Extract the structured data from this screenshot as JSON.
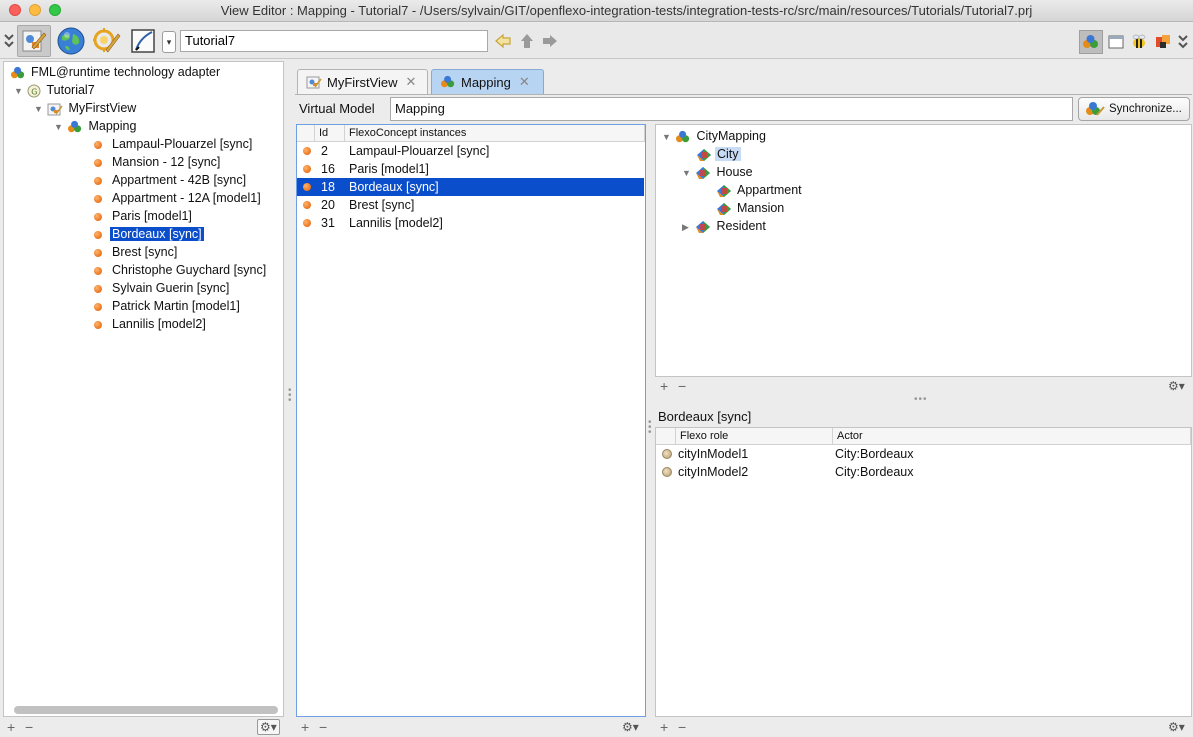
{
  "window": {
    "title": "View Editor : Mapping - Tutorial7 - /Users/sylvain/GIT/openflexo-integration-tests/integration-tests-rc/src/main/resources/Tutorials/Tutorial7.prj"
  },
  "toolbar": {
    "project_field": "Tutorial7"
  },
  "left_tree": {
    "root": "FML@runtime technology adapter",
    "project": "Tutorial7",
    "view": "MyFirstView",
    "virtual_model": "Mapping",
    "items": [
      "Lampaul-Plouarzel [sync]",
      "Mansion - 12 [sync]",
      "Appartment -  42B [sync]",
      "Appartment -  12A [model1]",
      "Paris [model1]",
      "Bordeaux [sync]",
      "Brest [sync]",
      "Christophe Guychard [sync]",
      "Sylvain Guerin [sync]",
      "Patrick Martin [model1]",
      "Lannilis [model2]"
    ],
    "selected_index": 5
  },
  "tabs": [
    {
      "label": "MyFirstView"
    },
    {
      "label": "Mapping"
    }
  ],
  "virtual_model": {
    "label": "Virtual Model",
    "value": "Mapping",
    "sync_button": "Synchronize..."
  },
  "instances_table": {
    "headers": [
      "Id",
      "FlexoConcept instances"
    ],
    "rows": [
      {
        "id": "2",
        "name": "Lampaul-Plouarzel [sync]"
      },
      {
        "id": "16",
        "name": "Paris [model1]"
      },
      {
        "id": "18",
        "name": "Bordeaux [sync]"
      },
      {
        "id": "20",
        "name": "Brest [sync]"
      },
      {
        "id": "31",
        "name": "Lannilis [model2]"
      }
    ],
    "selected_index": 2
  },
  "concept_tree": {
    "root": "CityMapping",
    "city": "City",
    "house": "House",
    "appartment": "Appartment",
    "mansion": "Mansion",
    "resident": "Resident"
  },
  "detail": {
    "title": "Bordeaux [sync]",
    "headers": [
      "Flexo role",
      "Actor"
    ],
    "rows": [
      {
        "role": "cityInModel1",
        "actor": "City:Bordeaux"
      },
      {
        "role": "cityInModel2",
        "actor": "City:Bordeaux"
      }
    ]
  },
  "colors": {
    "selection": "#0b4ecc",
    "active_tab": "#b8d4f3",
    "highlight": "#c9dcf5"
  }
}
